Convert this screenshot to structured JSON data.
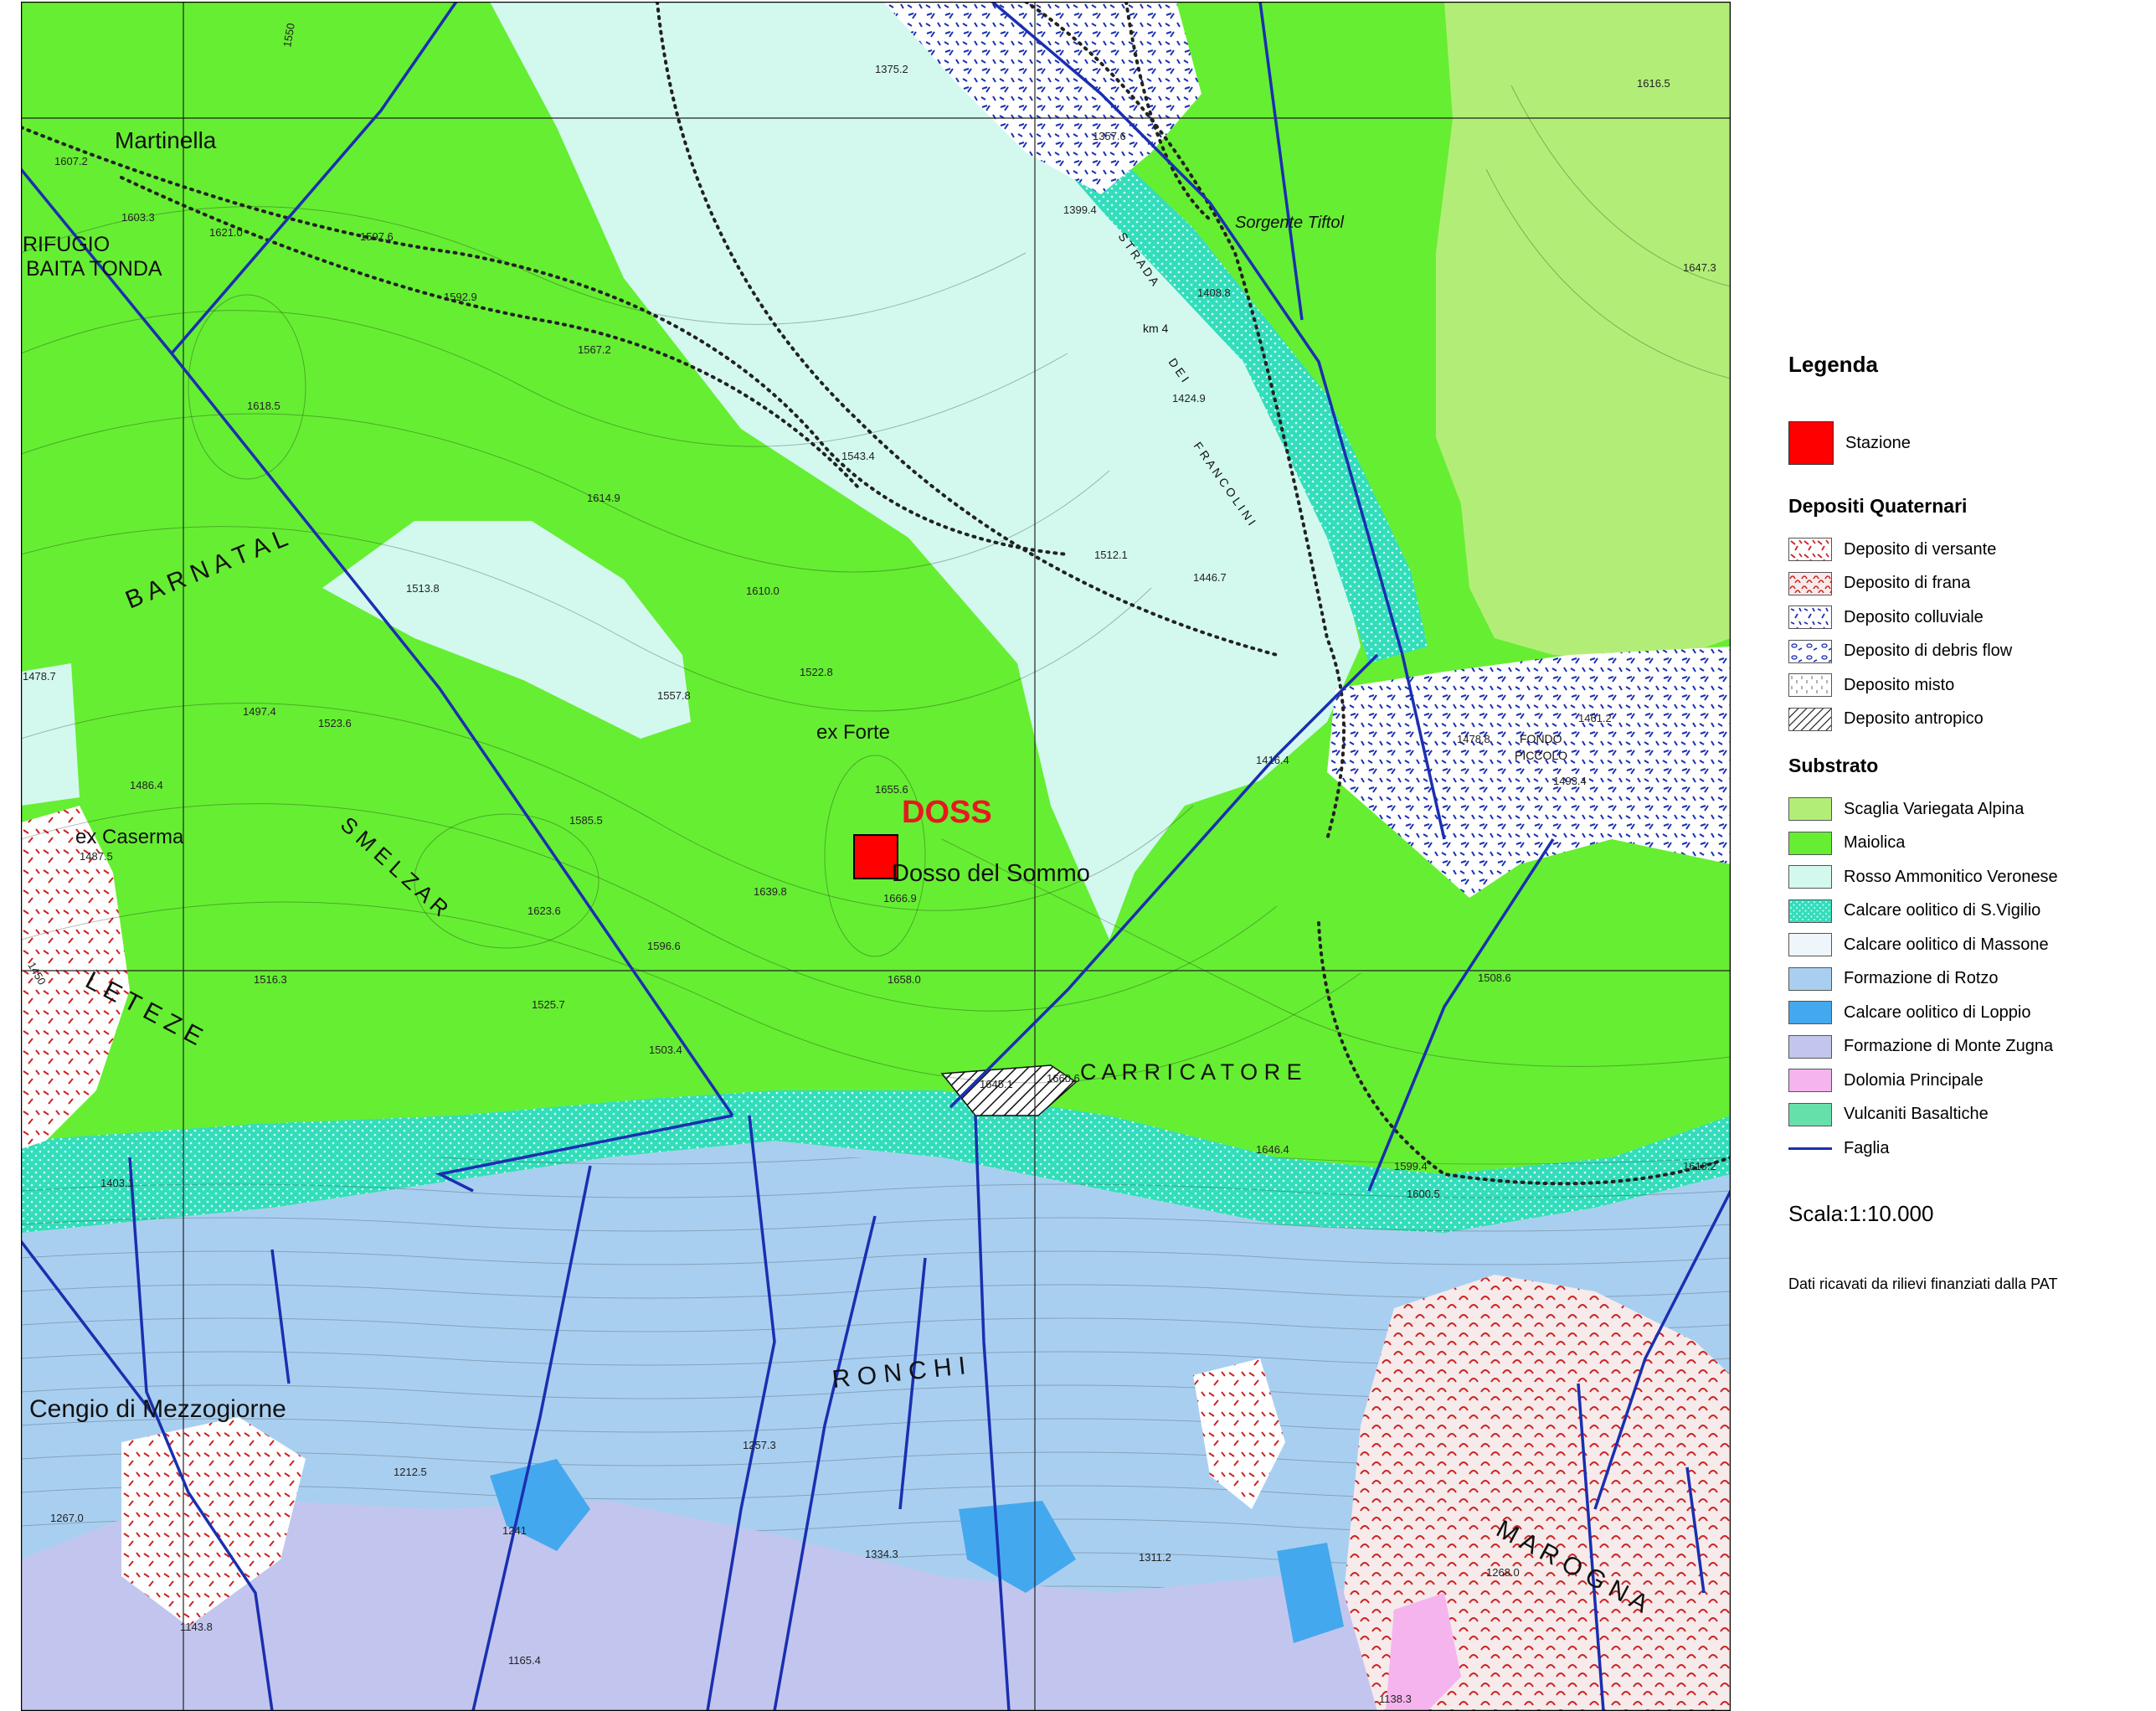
{
  "map": {
    "place_labels": {
      "martinella": "Martinella",
      "rifugio": "RIFUGIO",
      "baita_tonda": "BAITA TONDA",
      "barnatal": "B A R N A T A L",
      "smelzar": "S M E L Z A R",
      "ex_caserma": "ex Caserma",
      "ex_forte": "ex Forte",
      "doss_station": "DOSS",
      "dosso_del_sommo": "Dosso del Sommo",
      "carricatore": "C A R R I C A T O R E",
      "le_teze": "L E   T E Z E",
      "ronchi": "R O N C H I",
      "cengio": "Cengio di Mezzogiorne",
      "marogna": "M A R O G N A",
      "sorgente": "Sorgente Tiftol",
      "fondo_piccolo_1": "FONDO",
      "fondo_piccolo_2": "PICCOLO",
      "strada_1": "S T R A D A",
      "strada_2": "D E I",
      "strada_3": "F R A N C O L I N I",
      "km4": "km 4"
    },
    "elevations": [
      "1607.2",
      "1603.3",
      "1621.0",
      "1597.6",
      "1592.9",
      "1618.5",
      "1567.2",
      "1543.4",
      "1614.9",
      "1513.8",
      "1610.0",
      "1522.8",
      "1557.8",
      "1497.4",
      "1523.6",
      "1486.4",
      "1487.5",
      "1585.5",
      "1655.6",
      "1639.8",
      "1666.9",
      "1623.6",
      "1596.6",
      "1516.3",
      "1525.7",
      "1503.4",
      "1658.0",
      "1645.1",
      "1660.6",
      "1646.4",
      "1599.4",
      "1600.5",
      "1618.2",
      "1508.6",
      "1416.4",
      "1478.8",
      "1461.2",
      "1493.4",
      "1375.2",
      "1357.6",
      "1399.4",
      "1408.8",
      "1424.9",
      "1512.1",
      "1446.7",
      "1616.5",
      "1647.3",
      "1403.1",
      "1212.5",
      "1257.3",
      "1267.0",
      "1241",
      "1334.3",
      "1311.2",
      "1165.4",
      "1143.8",
      "1268.0",
      "1138.3",
      "1550",
      "1450",
      "1478.7"
    ],
    "colors": {
      "maiolica": "#66ee33",
      "scaglia": "#b2ee77",
      "rosso_ammonitico": "#d3f9ef",
      "calcare_svigilio": "#33ddbb",
      "calcare_massone": "#eef6fb",
      "rotzo": "#a9cff0",
      "loppio": "#44a8ee",
      "monte_zugna": "#c2c6ee",
      "dolomia": "#f5b4ee",
      "vulcaniti": "#66e0aa",
      "faglia": "#1a2fb0",
      "stazione": "#ff0000",
      "frana_red": "#cc2222"
    }
  },
  "legend": {
    "title": "Legenda",
    "station": {
      "label": "Stazione",
      "color": "#ff0000"
    },
    "quaternary_header": "Depositi Quaternari",
    "quaternary": [
      {
        "label": "Deposito di versante",
        "pattern": "versante"
      },
      {
        "label": "Deposito di frana",
        "pattern": "frana"
      },
      {
        "label": "Deposito colluviale",
        "pattern": "colluviale"
      },
      {
        "label": "Deposito di debris flow",
        "pattern": "debris"
      },
      {
        "label": "Deposito misto",
        "pattern": "misto"
      },
      {
        "label": "Deposito antropico",
        "pattern": "antropico"
      }
    ],
    "substrate_header": "Substrato",
    "substrate": [
      {
        "label": "Scaglia Variegata Alpina",
        "color": "#b2ee77",
        "pattern": ""
      },
      {
        "label": "Maiolica",
        "color": "#66ee33",
        "pattern": ""
      },
      {
        "label": "Rosso Ammonitico Veronese",
        "color": "#d3f9ef",
        "pattern": ""
      },
      {
        "label": "Calcare oolitico di S.Vigilio",
        "color": "#33ddbb",
        "pattern": "dots"
      },
      {
        "label": "Calcare oolitico di Massone",
        "color": "#eef6fb",
        "pattern": ""
      },
      {
        "label": "Formazione di Rotzo",
        "color": "#a9cff0",
        "pattern": ""
      },
      {
        "label": "Calcare oolitico di Loppio",
        "color": "#44a8ee",
        "pattern": ""
      },
      {
        "label": "Formazione di Monte Zugna",
        "color": "#c2c6ee",
        "pattern": ""
      },
      {
        "label": "Dolomia Principale",
        "color": "#f5b4ee",
        "pattern": ""
      },
      {
        "label": "Vulcaniti Basaltiche",
        "color": "#66e0aa",
        "pattern": ""
      }
    ],
    "fault": {
      "label": "Faglia",
      "color": "#1a2fb0"
    },
    "scale": "Scala:1:10.000",
    "note": "Dati ricavati da rilievi finanziati dalla PAT"
  }
}
